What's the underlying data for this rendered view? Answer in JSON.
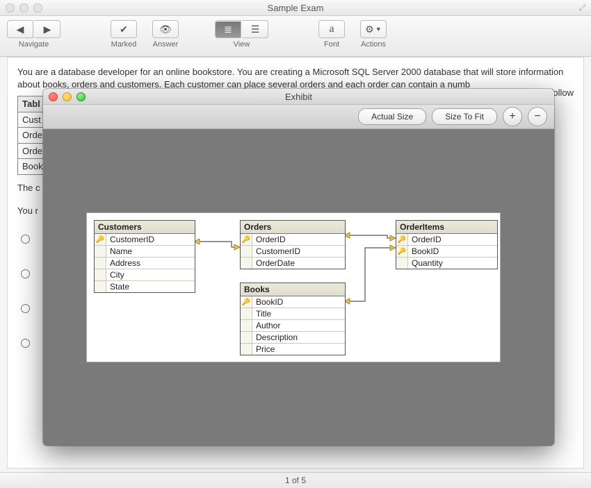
{
  "titlebar": {
    "title": "Sample Exam"
  },
  "toolbar": {
    "navigate": "Navigate",
    "marked": "Marked",
    "answer": "Answer",
    "view": "View",
    "font": "Font",
    "font_sample": "a",
    "actions": "Actions"
  },
  "question": {
    "text_visible": "You are a database developer for an online bookstore. You are creating a Microsoft SQL Server 2000 database that will store information about books, orders and customers. Each customer can place several orders and each order can contain a numb",
    "trailing_fragment": "n the follow",
    "after_table_1": "The c",
    "after_table_2": "You r",
    "table_header": "Tabl",
    "table_rows": [
      "Cust",
      "Orde",
      "Orde",
      "Book"
    ]
  },
  "status": {
    "text": "1 of 5"
  },
  "exhibit": {
    "title": "Exhibit",
    "actual_size": "Actual Size",
    "size_to_fit": "Size To Fit",
    "zoom_in": "+",
    "zoom_out": "−"
  },
  "diagram": {
    "tables": {
      "customers": {
        "title": "Customers",
        "cols": [
          {
            "name": "CustomerID",
            "pk": true
          },
          {
            "name": "Name",
            "pk": false
          },
          {
            "name": "Address",
            "pk": false
          },
          {
            "name": "City",
            "pk": false
          },
          {
            "name": "State",
            "pk": false
          }
        ]
      },
      "orders": {
        "title": "Orders",
        "cols": [
          {
            "name": "OrderID",
            "pk": true
          },
          {
            "name": "CustomerID",
            "pk": false
          },
          {
            "name": "OrderDate",
            "pk": false
          }
        ]
      },
      "orderitems": {
        "title": "OrderItems",
        "cols": [
          {
            "name": "OrderID",
            "pk": true
          },
          {
            "name": "BookID",
            "pk": true
          },
          {
            "name": "Quantity",
            "pk": false
          }
        ]
      },
      "books": {
        "title": "Books",
        "cols": [
          {
            "name": "BookID",
            "pk": true
          },
          {
            "name": "Title",
            "pk": false
          },
          {
            "name": "Author",
            "pk": false
          },
          {
            "name": "Description",
            "pk": false
          },
          {
            "name": "Price",
            "pk": false
          }
        ]
      }
    }
  }
}
